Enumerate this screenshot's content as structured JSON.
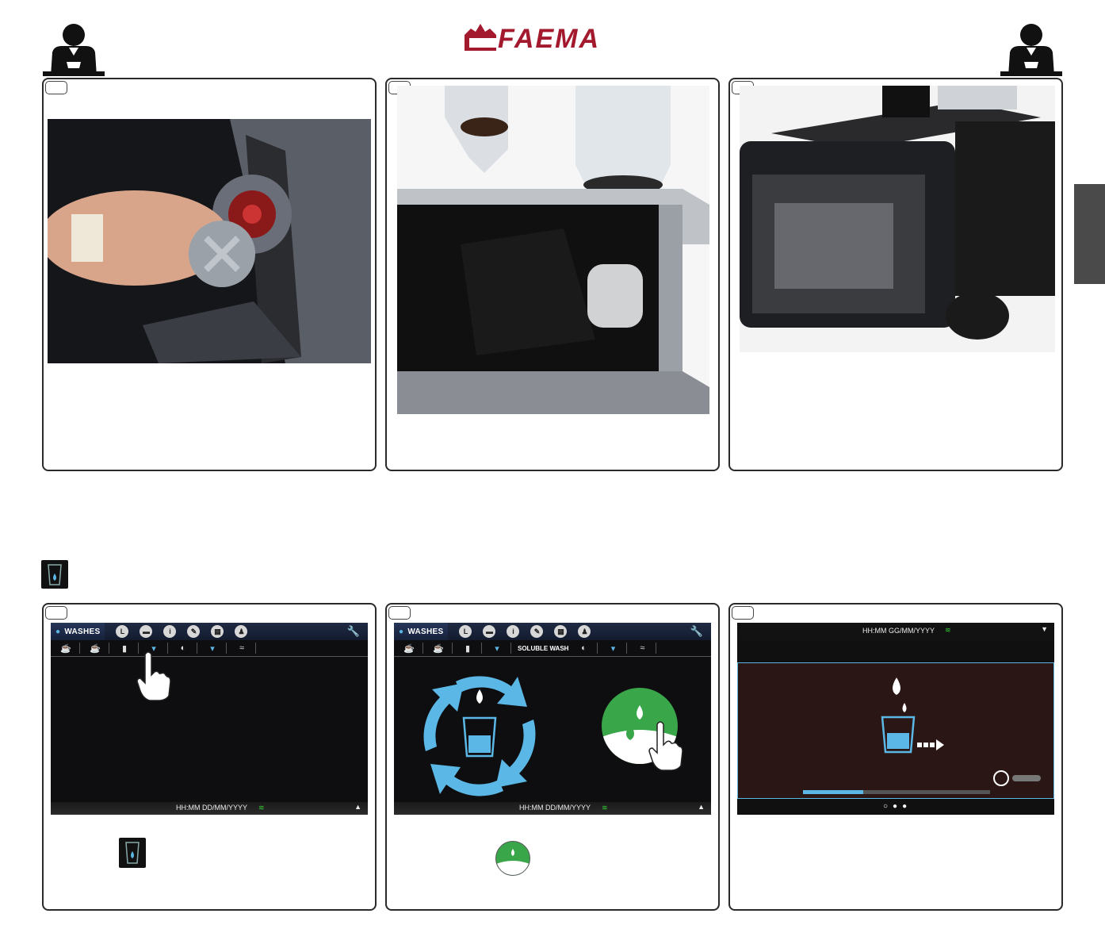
{
  "brand": {
    "name": "FAEMA",
    "color": "#a3192d"
  },
  "icons": {
    "left_waiter": "waiter-icon",
    "right_waiter": "waiter-icon",
    "section_glass": "glass-wash-icon"
  },
  "screens": {
    "menu_label": "WASHES",
    "soluble_label": "SOLUBLE WASH",
    "status_time_1": "HH:MM DD/MM/YYYY",
    "status_time_2": "HH:MM DD/MM/YYYY",
    "status_time_3": "HH:MM GG/MM/YYYY"
  },
  "colors": {
    "accent_blue": "#5bb8e6",
    "go_green": "#3aa64a",
    "side_tab": "#4a4a4a"
  }
}
